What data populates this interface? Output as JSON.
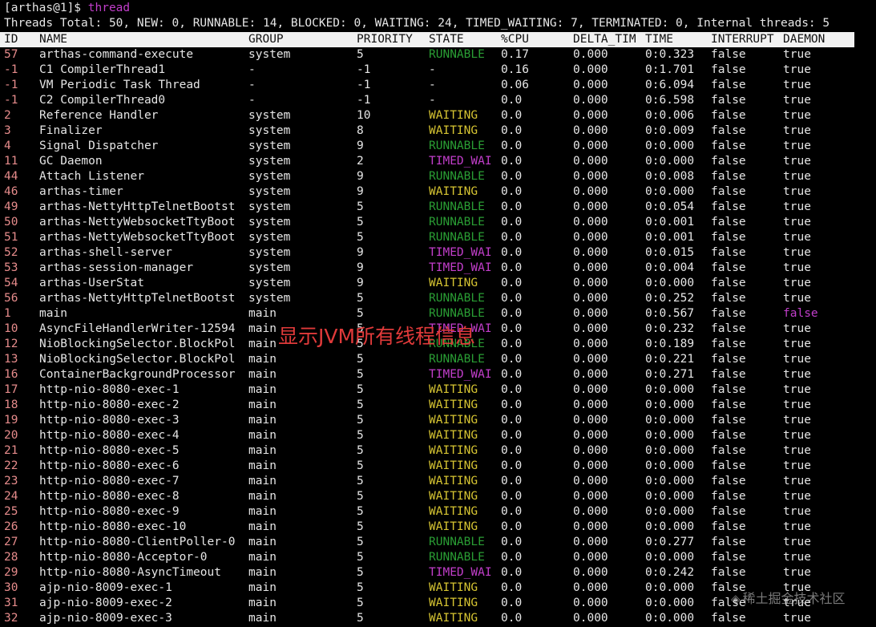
{
  "terminal": {
    "prompt": "[arthas@1]$ ",
    "command": "thread",
    "summary": "Threads Total: 50, NEW: 0, RUNNABLE: 14, BLOCKED: 0, WAITING: 24, TIMED_WAITING: 7, TERMINATED: 0, Internal threads: 5"
  },
  "columns": [
    "ID",
    "NAME",
    "GROUP",
    "PRIORITY",
    "STATE",
    "%CPU",
    "DELTA_TIM",
    "TIME",
    "INTERRUPT",
    "DAEMON"
  ],
  "rows": [
    {
      "id": "57",
      "name": "arthas-command-execute",
      "group": "system",
      "priority": "5",
      "state": "RUNNABLE",
      "cpu": "0.17",
      "delta": "0.000",
      "time": "0:0.323",
      "interrupt": "false",
      "daemon": "true"
    },
    {
      "id": "-1",
      "name": "C1 CompilerThread1",
      "group": "-",
      "priority": "-1",
      "state": "-",
      "cpu": "0.16",
      "delta": "0.000",
      "time": "0:1.701",
      "interrupt": "false",
      "daemon": "true"
    },
    {
      "id": "-1",
      "name": "VM Periodic Task Thread",
      "group": "-",
      "priority": "-1",
      "state": "-",
      "cpu": "0.06",
      "delta": "0.000",
      "time": "0:6.094",
      "interrupt": "false",
      "daemon": "true"
    },
    {
      "id": "-1",
      "name": "C2 CompilerThread0",
      "group": "-",
      "priority": "-1",
      "state": "-",
      "cpu": "0.0",
      "delta": "0.000",
      "time": "0:6.598",
      "interrupt": "false",
      "daemon": "true"
    },
    {
      "id": "2",
      "name": "Reference Handler",
      "group": "system",
      "priority": "10",
      "state": "WAITING",
      "cpu": "0.0",
      "delta": "0.000",
      "time": "0:0.006",
      "interrupt": "false",
      "daemon": "true"
    },
    {
      "id": "3",
      "name": "Finalizer",
      "group": "system",
      "priority": "8",
      "state": "WAITING",
      "cpu": "0.0",
      "delta": "0.000",
      "time": "0:0.009",
      "interrupt": "false",
      "daemon": "true"
    },
    {
      "id": "4",
      "name": "Signal Dispatcher",
      "group": "system",
      "priority": "9",
      "state": "RUNNABLE",
      "cpu": "0.0",
      "delta": "0.000",
      "time": "0:0.000",
      "interrupt": "false",
      "daemon": "true"
    },
    {
      "id": "11",
      "name": "GC Daemon",
      "group": "system",
      "priority": "2",
      "state": "TIMED_WAI",
      "cpu": "0.0",
      "delta": "0.000",
      "time": "0:0.000",
      "interrupt": "false",
      "daemon": "true"
    },
    {
      "id": "44",
      "name": "Attach Listener",
      "group": "system",
      "priority": "9",
      "state": "RUNNABLE",
      "cpu": "0.0",
      "delta": "0.000",
      "time": "0:0.008",
      "interrupt": "false",
      "daemon": "true"
    },
    {
      "id": "46",
      "name": "arthas-timer",
      "group": "system",
      "priority": "9",
      "state": "WAITING",
      "cpu": "0.0",
      "delta": "0.000",
      "time": "0:0.000",
      "interrupt": "false",
      "daemon": "true"
    },
    {
      "id": "49",
      "name": "arthas-NettyHttpTelnetBootst",
      "group": "system",
      "priority": "5",
      "state": "RUNNABLE",
      "cpu": "0.0",
      "delta": "0.000",
      "time": "0:0.054",
      "interrupt": "false",
      "daemon": "true"
    },
    {
      "id": "50",
      "name": "arthas-NettyWebsocketTtyBoot",
      "group": "system",
      "priority": "5",
      "state": "RUNNABLE",
      "cpu": "0.0",
      "delta": "0.000",
      "time": "0:0.001",
      "interrupt": "false",
      "daemon": "true"
    },
    {
      "id": "51",
      "name": "arthas-NettyWebsocketTtyBoot",
      "group": "system",
      "priority": "5",
      "state": "RUNNABLE",
      "cpu": "0.0",
      "delta": "0.000",
      "time": "0:0.001",
      "interrupt": "false",
      "daemon": "true"
    },
    {
      "id": "52",
      "name": "arthas-shell-server",
      "group": "system",
      "priority": "9",
      "state": "TIMED_WAI",
      "cpu": "0.0",
      "delta": "0.000",
      "time": "0:0.015",
      "interrupt": "false",
      "daemon": "true"
    },
    {
      "id": "53",
      "name": "arthas-session-manager",
      "group": "system",
      "priority": "9",
      "state": "TIMED_WAI",
      "cpu": "0.0",
      "delta": "0.000",
      "time": "0:0.004",
      "interrupt": "false",
      "daemon": "true"
    },
    {
      "id": "54",
      "name": "arthas-UserStat",
      "group": "system",
      "priority": "9",
      "state": "WAITING",
      "cpu": "0.0",
      "delta": "0.000",
      "time": "0:0.000",
      "interrupt": "false",
      "daemon": "true"
    },
    {
      "id": "56",
      "name": "arthas-NettyHttpTelnetBootst",
      "group": "system",
      "priority": "5",
      "state": "RUNNABLE",
      "cpu": "0.0",
      "delta": "0.000",
      "time": "0:0.252",
      "interrupt": "false",
      "daemon": "true"
    },
    {
      "id": "1",
      "name": "main",
      "group": "main",
      "priority": "5",
      "state": "RUNNABLE",
      "cpu": "0.0",
      "delta": "0.000",
      "time": "0:0.567",
      "interrupt": "false",
      "daemon": "false"
    },
    {
      "id": "10",
      "name": "AsyncFileHandlerWriter-12594",
      "group": "main",
      "priority": "5",
      "state": "TIMED_WAI",
      "cpu": "0.0",
      "delta": "0.000",
      "time": "0:0.232",
      "interrupt": "false",
      "daemon": "true"
    },
    {
      "id": "12",
      "name": "NioBlockingSelector.BlockPol",
      "group": "main",
      "priority": "5",
      "state": "RUNNABLE",
      "cpu": "0.0",
      "delta": "0.000",
      "time": "0:0.189",
      "interrupt": "false",
      "daemon": "true"
    },
    {
      "id": "13",
      "name": "NioBlockingSelector.BlockPol",
      "group": "main",
      "priority": "5",
      "state": "RUNNABLE",
      "cpu": "0.0",
      "delta": "0.000",
      "time": "0:0.221",
      "interrupt": "false",
      "daemon": "true"
    },
    {
      "id": "16",
      "name": "ContainerBackgroundProcessor",
      "group": "main",
      "priority": "5",
      "state": "TIMED_WAI",
      "cpu": "0.0",
      "delta": "0.000",
      "time": "0:0.271",
      "interrupt": "false",
      "daemon": "true"
    },
    {
      "id": "17",
      "name": "http-nio-8080-exec-1",
      "group": "main",
      "priority": "5",
      "state": "WAITING",
      "cpu": "0.0",
      "delta": "0.000",
      "time": "0:0.000",
      "interrupt": "false",
      "daemon": "true"
    },
    {
      "id": "18",
      "name": "http-nio-8080-exec-2",
      "group": "main",
      "priority": "5",
      "state": "WAITING",
      "cpu": "0.0",
      "delta": "0.000",
      "time": "0:0.000",
      "interrupt": "false",
      "daemon": "true"
    },
    {
      "id": "19",
      "name": "http-nio-8080-exec-3",
      "group": "main",
      "priority": "5",
      "state": "WAITING",
      "cpu": "0.0",
      "delta": "0.000",
      "time": "0:0.000",
      "interrupt": "false",
      "daemon": "true"
    },
    {
      "id": "20",
      "name": "http-nio-8080-exec-4",
      "group": "main",
      "priority": "5",
      "state": "WAITING",
      "cpu": "0.0",
      "delta": "0.000",
      "time": "0:0.000",
      "interrupt": "false",
      "daemon": "true"
    },
    {
      "id": "21",
      "name": "http-nio-8080-exec-5",
      "group": "main",
      "priority": "5",
      "state": "WAITING",
      "cpu": "0.0",
      "delta": "0.000",
      "time": "0:0.000",
      "interrupt": "false",
      "daemon": "true"
    },
    {
      "id": "22",
      "name": "http-nio-8080-exec-6",
      "group": "main",
      "priority": "5",
      "state": "WAITING",
      "cpu": "0.0",
      "delta": "0.000",
      "time": "0:0.000",
      "interrupt": "false",
      "daemon": "true"
    },
    {
      "id": "23",
      "name": "http-nio-8080-exec-7",
      "group": "main",
      "priority": "5",
      "state": "WAITING",
      "cpu": "0.0",
      "delta": "0.000",
      "time": "0:0.000",
      "interrupt": "false",
      "daemon": "true"
    },
    {
      "id": "24",
      "name": "http-nio-8080-exec-8",
      "group": "main",
      "priority": "5",
      "state": "WAITING",
      "cpu": "0.0",
      "delta": "0.000",
      "time": "0:0.000",
      "interrupt": "false",
      "daemon": "true"
    },
    {
      "id": "25",
      "name": "http-nio-8080-exec-9",
      "group": "main",
      "priority": "5",
      "state": "WAITING",
      "cpu": "0.0",
      "delta": "0.000",
      "time": "0:0.000",
      "interrupt": "false",
      "daemon": "true"
    },
    {
      "id": "26",
      "name": "http-nio-8080-exec-10",
      "group": "main",
      "priority": "5",
      "state": "WAITING",
      "cpu": "0.0",
      "delta": "0.000",
      "time": "0:0.000",
      "interrupt": "false",
      "daemon": "true"
    },
    {
      "id": "27",
      "name": "http-nio-8080-ClientPoller-0",
      "group": "main",
      "priority": "5",
      "state": "RUNNABLE",
      "cpu": "0.0",
      "delta": "0.000",
      "time": "0:0.277",
      "interrupt": "false",
      "daemon": "true"
    },
    {
      "id": "28",
      "name": "http-nio-8080-Acceptor-0",
      "group": "main",
      "priority": "5",
      "state": "RUNNABLE",
      "cpu": "0.0",
      "delta": "0.000",
      "time": "0:0.000",
      "interrupt": "false",
      "daemon": "true"
    },
    {
      "id": "29",
      "name": "http-nio-8080-AsyncTimeout",
      "group": "main",
      "priority": "5",
      "state": "TIMED_WAI",
      "cpu": "0.0",
      "delta": "0.000",
      "time": "0:0.242",
      "interrupt": "false",
      "daemon": "true"
    },
    {
      "id": "30",
      "name": "ajp-nio-8009-exec-1",
      "group": "main",
      "priority": "5",
      "state": "WAITING",
      "cpu": "0.0",
      "delta": "0.000",
      "time": "0:0.000",
      "interrupt": "false",
      "daemon": "true"
    },
    {
      "id": "31",
      "name": "ajp-nio-8009-exec-2",
      "group": "main",
      "priority": "5",
      "state": "WAITING",
      "cpu": "0.0",
      "delta": "0.000",
      "time": "0:0.000",
      "interrupt": "false",
      "daemon": "true"
    },
    {
      "id": "32",
      "name": "ajp-nio-8009-exec-3",
      "group": "main",
      "priority": "5",
      "state": "WAITING",
      "cpu": "0.0",
      "delta": "0.000",
      "time": "0:0.000",
      "interrupt": "false",
      "daemon": "true"
    }
  ],
  "annotation": "显示JVM所有线程信息",
  "watermark": {
    "icon": "juejin-logo-icon",
    "text": "稀土掘金技术社区"
  },
  "colors": {
    "background": "#000000",
    "text": "#e6e6e6",
    "id": "#e58b8b",
    "runnable": "#2a9e34",
    "waiting": "#d6c432",
    "timed_waiting": "#c23ecb",
    "daemon_false": "#c23ecb",
    "command": "#c23ecb",
    "annotation": "#e03a3a",
    "header_bg": "#f2f2f2"
  }
}
